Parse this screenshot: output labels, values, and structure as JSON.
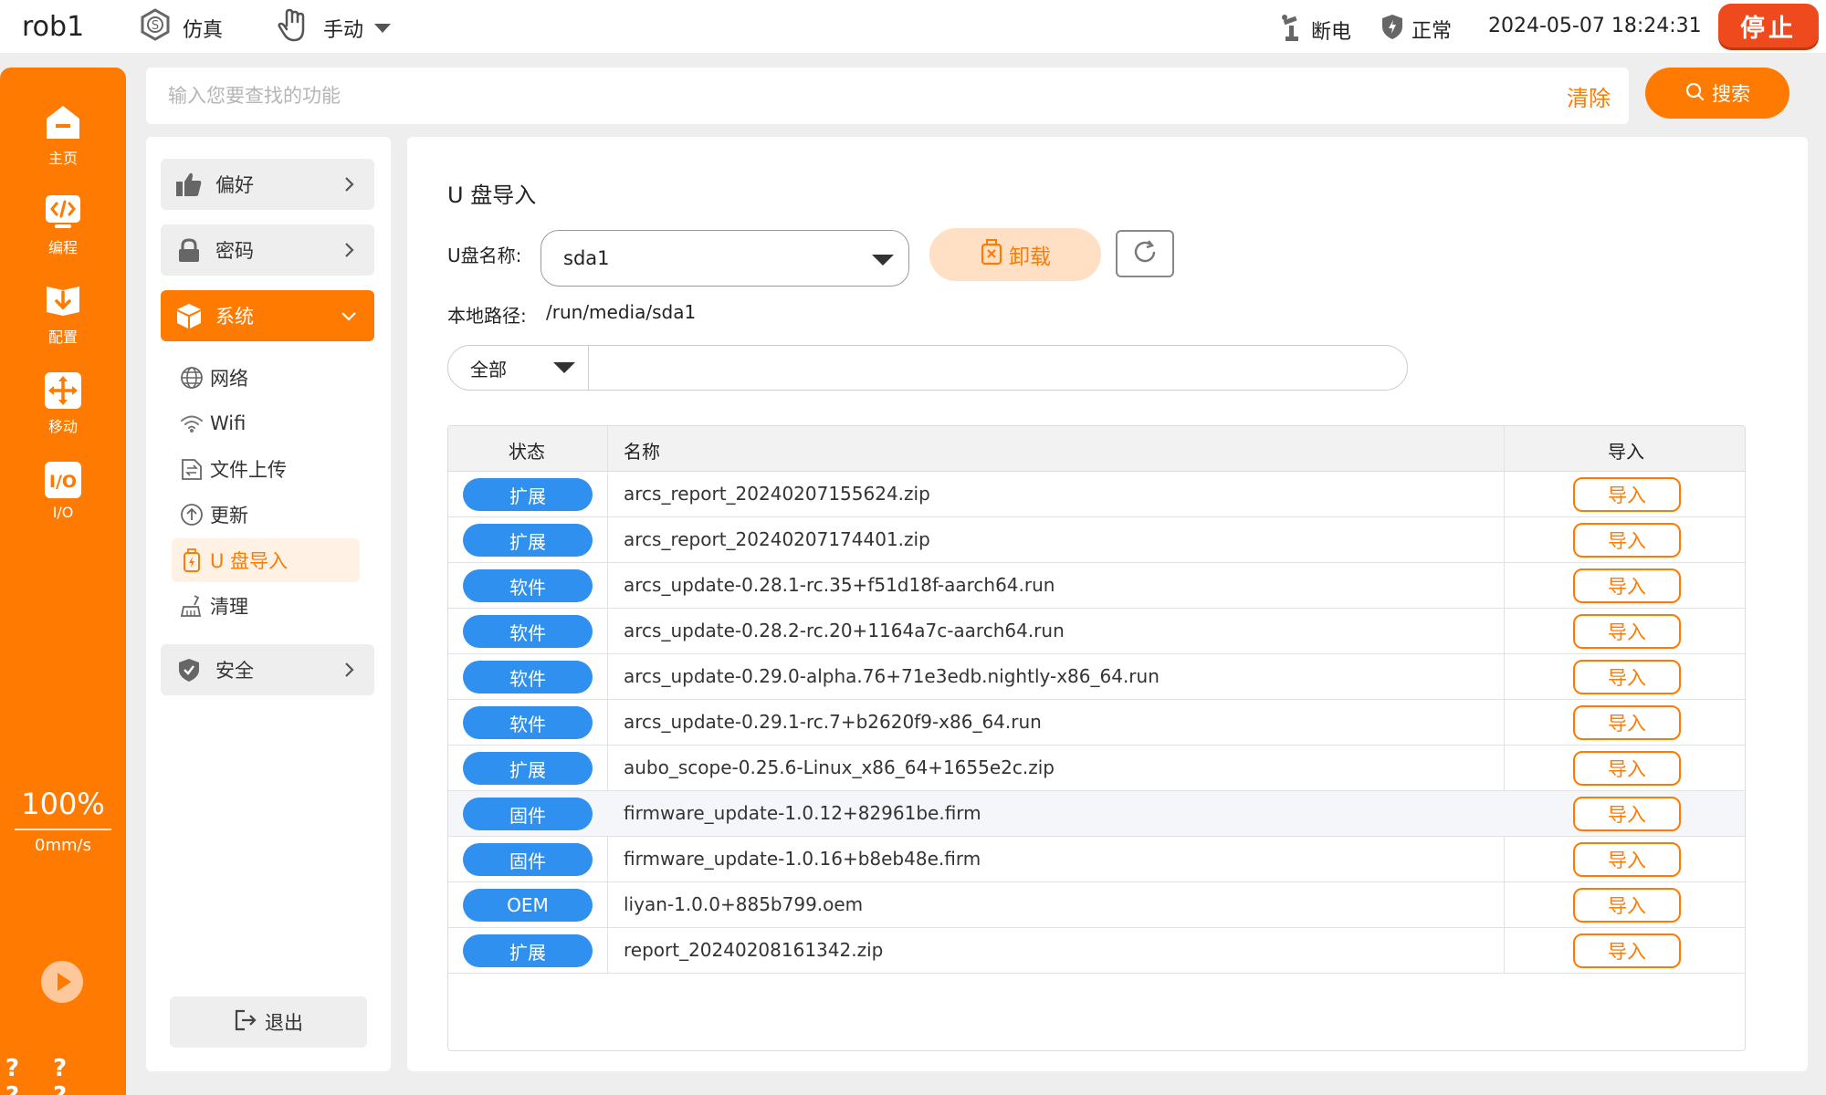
{
  "topbar": {
    "robot_name": "rob1",
    "sim_label": "仿真",
    "mode_label": "手动",
    "power_label": "断电",
    "safety_label": "正常",
    "datetime": "2024-05-07 18:24:31",
    "stop_label": "停止"
  },
  "leftnav": {
    "items": [
      {
        "label": "主页",
        "icon": "home-icon"
      },
      {
        "label": "编程",
        "icon": "code-icon"
      },
      {
        "label": "配置",
        "icon": "config-icon"
      },
      {
        "label": "移动",
        "icon": "move-icon"
      },
      {
        "label": "I/O",
        "icon": "io-icon"
      }
    ],
    "speed_percent": "100%",
    "speed_mms": "0mm/s",
    "qmarks": "? ? ? ?"
  },
  "search": {
    "placeholder": "输入您要查找的功能",
    "clear_label": "清除",
    "button_label": "搜索"
  },
  "menu": {
    "categories": {
      "preference": "偏好",
      "password": "密码",
      "system": "系统",
      "security": "安全"
    },
    "sub_items": [
      {
        "label": "网络",
        "icon": "globe-icon"
      },
      {
        "label": "Wifi",
        "icon": "wifi-icon"
      },
      {
        "label": "文件上传",
        "icon": "file-upload-icon"
      },
      {
        "label": "更新",
        "icon": "update-icon"
      },
      {
        "label": "U 盘导入",
        "icon": "usb-icon"
      },
      {
        "label": "清理",
        "icon": "broom-icon"
      }
    ],
    "logout_label": "退出"
  },
  "main": {
    "title": "U 盘导入",
    "usb_name_label": "U盘名称:",
    "usb_selected": "sda1",
    "unmount_label": "卸载",
    "local_path_label": "本地路径:",
    "local_path_value": "/run/media/sda1",
    "filter_selected": "全部",
    "filter_value": "",
    "table": {
      "headers": [
        "状态",
        "名称",
        "导入"
      ],
      "import_label": "导入",
      "rows": [
        {
          "status": "扩展",
          "name": "arcs_report_20240207155624.zip"
        },
        {
          "status": "扩展",
          "name": "arcs_report_20240207174401.zip"
        },
        {
          "status": "软件",
          "name": "arcs_update-0.28.1-rc.35+f51d18f-aarch64.run"
        },
        {
          "status": "软件",
          "name": "arcs_update-0.28.2-rc.20+1164a7c-aarch64.run"
        },
        {
          "status": "软件",
          "name": "arcs_update-0.29.0-alpha.76+71e3edb.nightly-x86_64.run"
        },
        {
          "status": "软件",
          "name": "arcs_update-0.29.1-rc.7+b2620f9-x86_64.run"
        },
        {
          "status": "扩展",
          "name": "aubo_scope-0.25.6-Linux_x86_64+1655e2c.zip"
        },
        {
          "status": "固件",
          "name": "firmware_update-1.0.12+82961be.firm"
        },
        {
          "status": "固件",
          "name": "firmware_update-1.0.16+b8eb48e.firm"
        },
        {
          "status": "OEM",
          "name": "liyan-1.0.0+885b799.oem"
        },
        {
          "status": "扩展",
          "name": "report_20240208161342.zip"
        }
      ]
    }
  },
  "colors": {
    "accent": "#ff7a00",
    "stop": "#ef4a1d",
    "badge": "#2f90f0"
  }
}
